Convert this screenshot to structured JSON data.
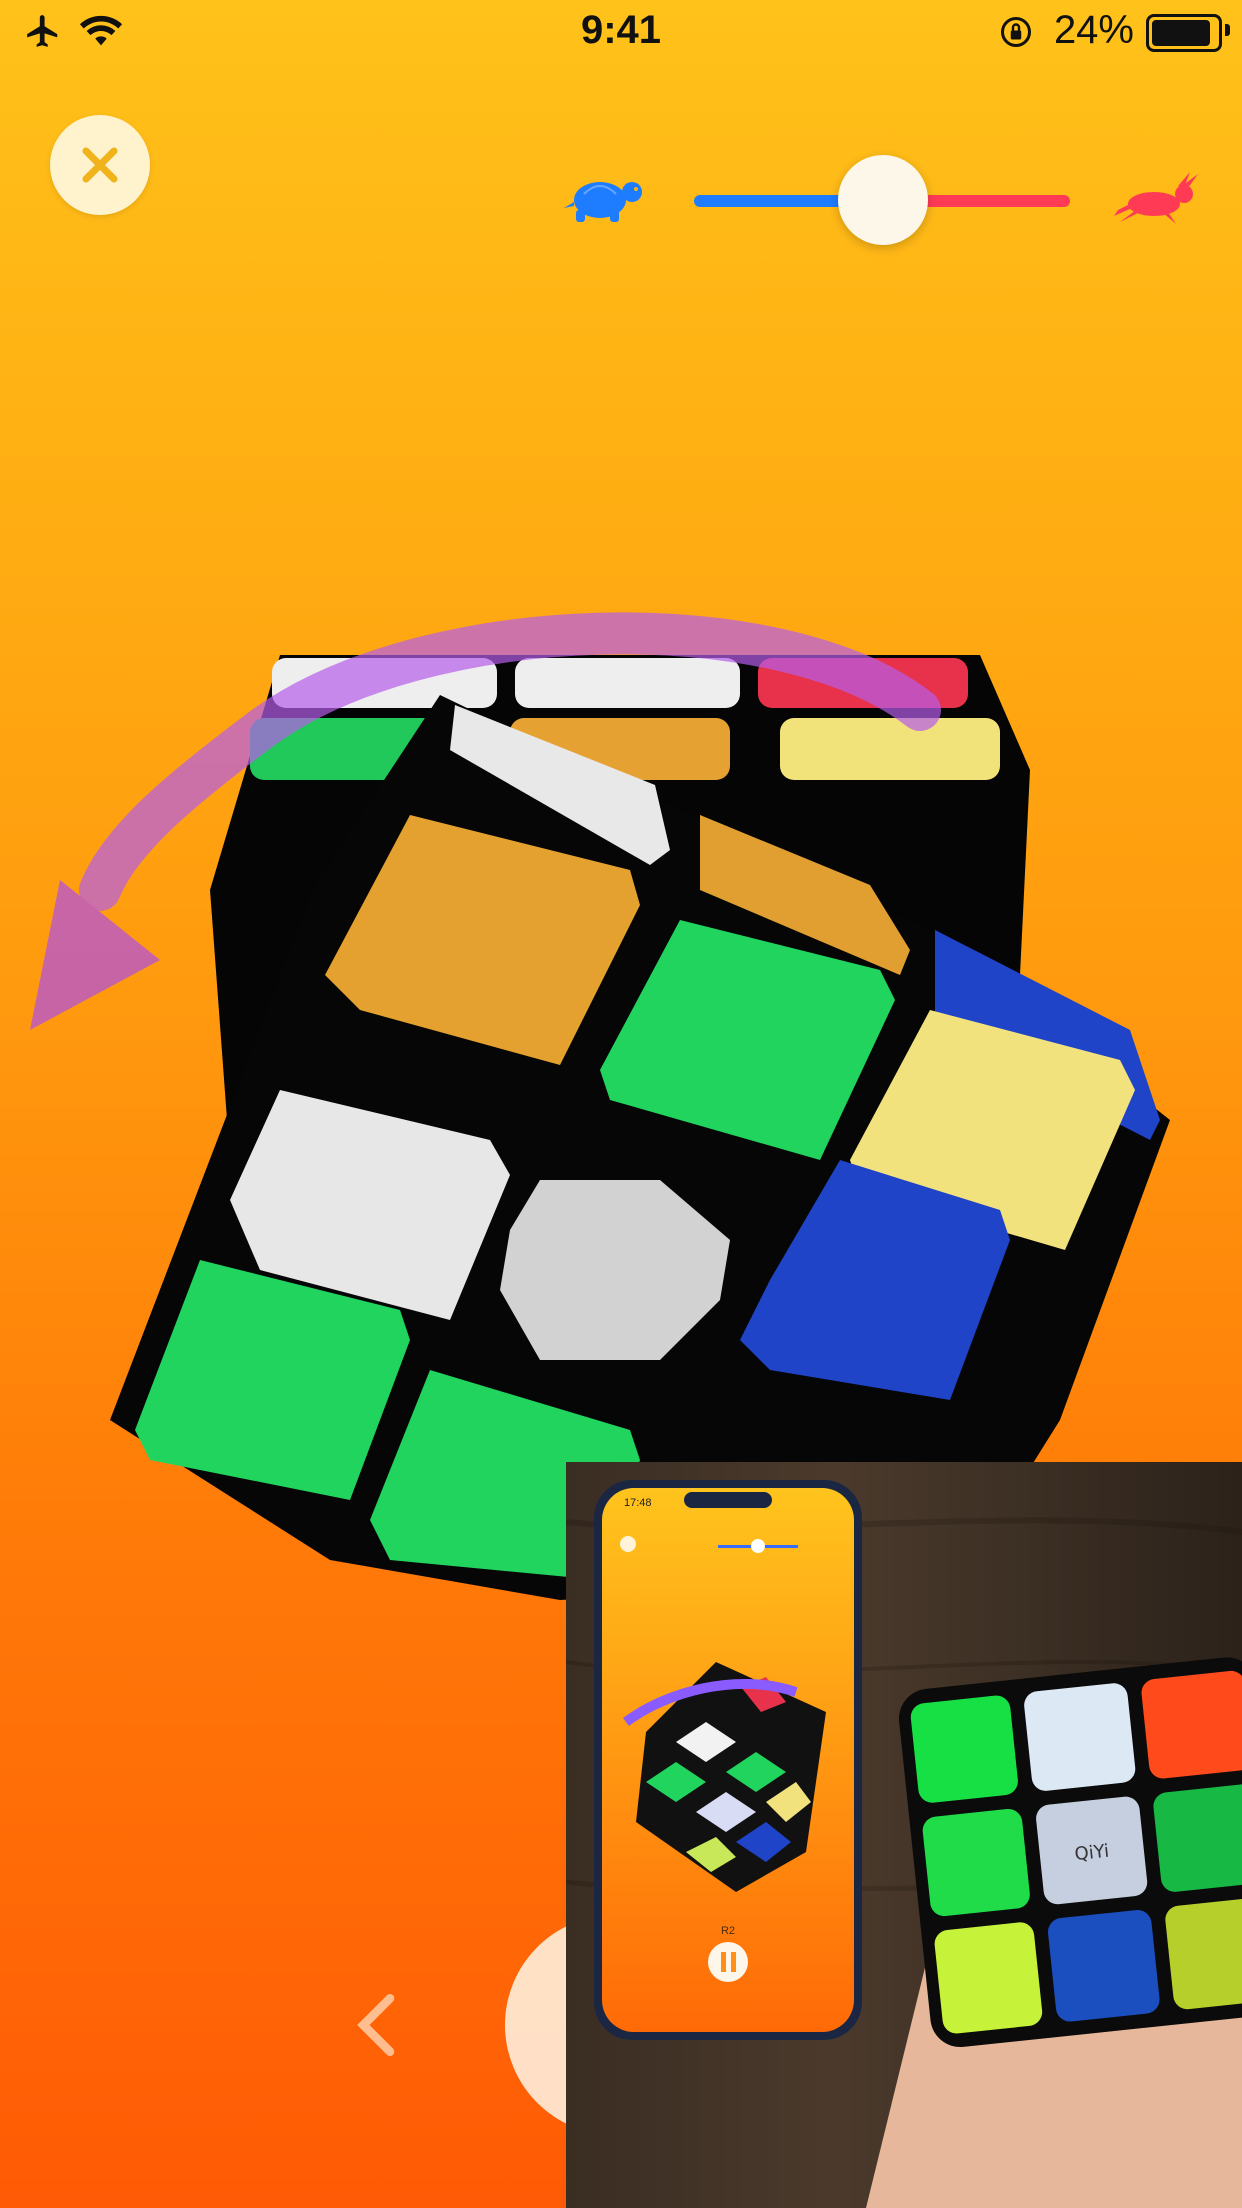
{
  "status_bar": {
    "time": "9:41",
    "battery": "24%",
    "icons": [
      "airplane-icon",
      "wifi-icon",
      "orientation-lock-icon",
      "battery-icon"
    ]
  },
  "controls": {
    "close_icon": "close-icon",
    "speed_slider": {
      "min_icon": "turtle-icon",
      "max_icon": "rabbit-icon",
      "value": 0.5
    },
    "back_icon": "chevron-left-icon",
    "play_icon": "play-pause-icon"
  },
  "cube": {
    "front_face": [
      "orange",
      "green",
      "yellow",
      "white",
      "white",
      "blue",
      "green",
      "green",
      "white"
    ],
    "rotation_hint": "counter-clockwise-arrow"
  },
  "inset_video": {
    "phone_time": "17:48",
    "phone_label": "R2",
    "center_logo_text": "QiYi"
  },
  "colors": {
    "gradient_top": "#ffc21a",
    "gradient_bottom": "#ff5a05",
    "slider_left": "#1e7cff",
    "slider_right": "#ff3a55",
    "close_accent": "#f0b31c"
  }
}
